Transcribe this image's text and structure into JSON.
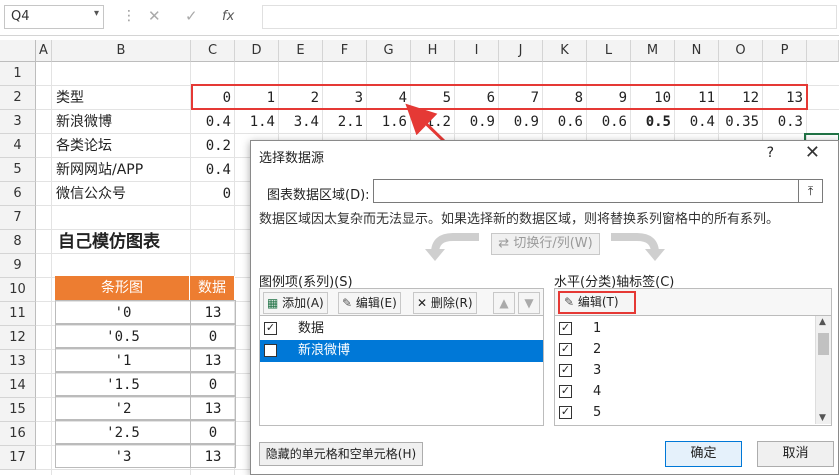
{
  "formula_bar": {
    "namebox": "Q4",
    "cancel": "✕",
    "enter": "✓",
    "fx": "fx"
  },
  "columns": [
    "A",
    "B",
    "C",
    "D",
    "E",
    "F",
    "G",
    "H",
    "I",
    "J",
    "K",
    "L",
    "M",
    "N",
    "O",
    "P"
  ],
  "rows": [
    "1",
    "2",
    "3",
    "4",
    "5",
    "6",
    "7",
    "8",
    "9",
    "10",
    "11",
    "12",
    "13",
    "14",
    "15",
    "16",
    "17"
  ],
  "sheet": {
    "row2_label": "类型",
    "row2_values": [
      "0",
      "1",
      "2",
      "3",
      "4",
      "5",
      "6",
      "7",
      "8",
      "9",
      "10",
      "11",
      "12",
      "13"
    ],
    "row3_label": "新浪微博",
    "row3_values": [
      "0.4",
      "1.4",
      "3.4",
      "2.1",
      "1.6",
      "1.2",
      "0.9",
      "0.9",
      "0.6",
      "0.6",
      "0.5",
      "0.4",
      "0.35",
      "0.3"
    ],
    "row4_label": "各类论坛",
    "row4_value": "0.2",
    "row5_label": "新网网站/APP",
    "row5_value": "0.4",
    "row6_label": "微信公众号",
    "row6_value": "0",
    "row8_title": "自己模仿图表",
    "table_headers": [
      "条形图",
      "数据"
    ],
    "table_rows": [
      [
        "'0",
        "13"
      ],
      [
        "'0.5",
        "0"
      ],
      [
        "'1",
        "13"
      ],
      [
        "'1.5",
        "0"
      ],
      [
        "'2",
        "13"
      ],
      [
        "'2.5",
        "0"
      ],
      [
        "'3",
        "13"
      ]
    ]
  },
  "dialog": {
    "title": "选择数据源",
    "help": "?",
    "close": "✕",
    "range_label": "图表数据区域(D):",
    "range_value": "",
    "info": "数据区域因太复杂而无法显示。如果选择新的数据区域，则将替换系列窗格中的所有系列。",
    "switch_label": "切换行/列(W)",
    "legend_label": "图例项(系列)(S)",
    "axis_label": "水平(分类)轴标签(C)",
    "add_label": "添加(A)",
    "edit_label": "编辑(E)",
    "delete_label": "删除(R)",
    "axis_edit_label": "编辑(T)",
    "legend_items": [
      {
        "label": "数据",
        "checked": true,
        "selected": false
      },
      {
        "label": "新浪微博",
        "checked": true,
        "selected": true
      }
    ],
    "axis_items": [
      "1",
      "2",
      "3",
      "4",
      "5"
    ],
    "hidden_cells_label": "隐藏的单元格和空单元格(H)",
    "ok_label": "确定",
    "cancel_label": "取消"
  },
  "colors": {
    "accent_red": "#e53935",
    "table_header": "#ed7d31",
    "selection_blue": "#0078d7",
    "cell_border": "#217346"
  }
}
